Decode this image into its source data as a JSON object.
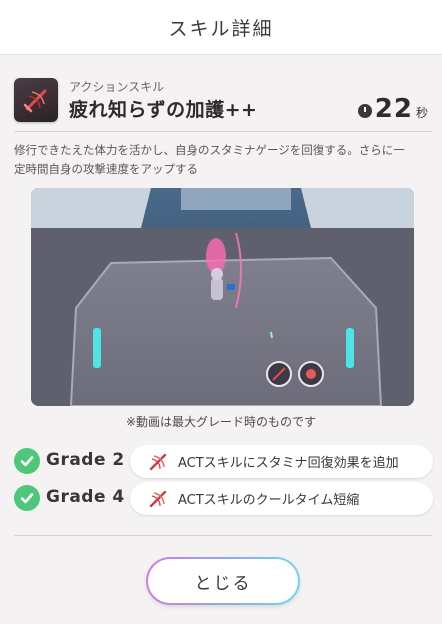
{
  "header": {
    "title": "スキル詳細"
  },
  "skill": {
    "type": "アクションスキル",
    "name": "疲れ知らずの加護++",
    "cooldown_value": "22",
    "cooldown_unit": "秒",
    "description_line1": "修行できたえた体力を活かし、自身のスタミナゲージを回復する。さらに一",
    "description_line2": "定時間自身の攻撃速度をアップする"
  },
  "video": {
    "caption": "※動画は最大グレード時のものです"
  },
  "grades": [
    {
      "label": "Grade 2",
      "effect": "ACTスキルにスタミナ回復効果を追加"
    },
    {
      "label": "Grade 4",
      "effect": "ACTスキルのクールタイム短縮"
    }
  ],
  "close_button": {
    "label": "とじる"
  },
  "colors": {
    "check": "#4fc77a",
    "accent_red": "#d83a3a"
  }
}
